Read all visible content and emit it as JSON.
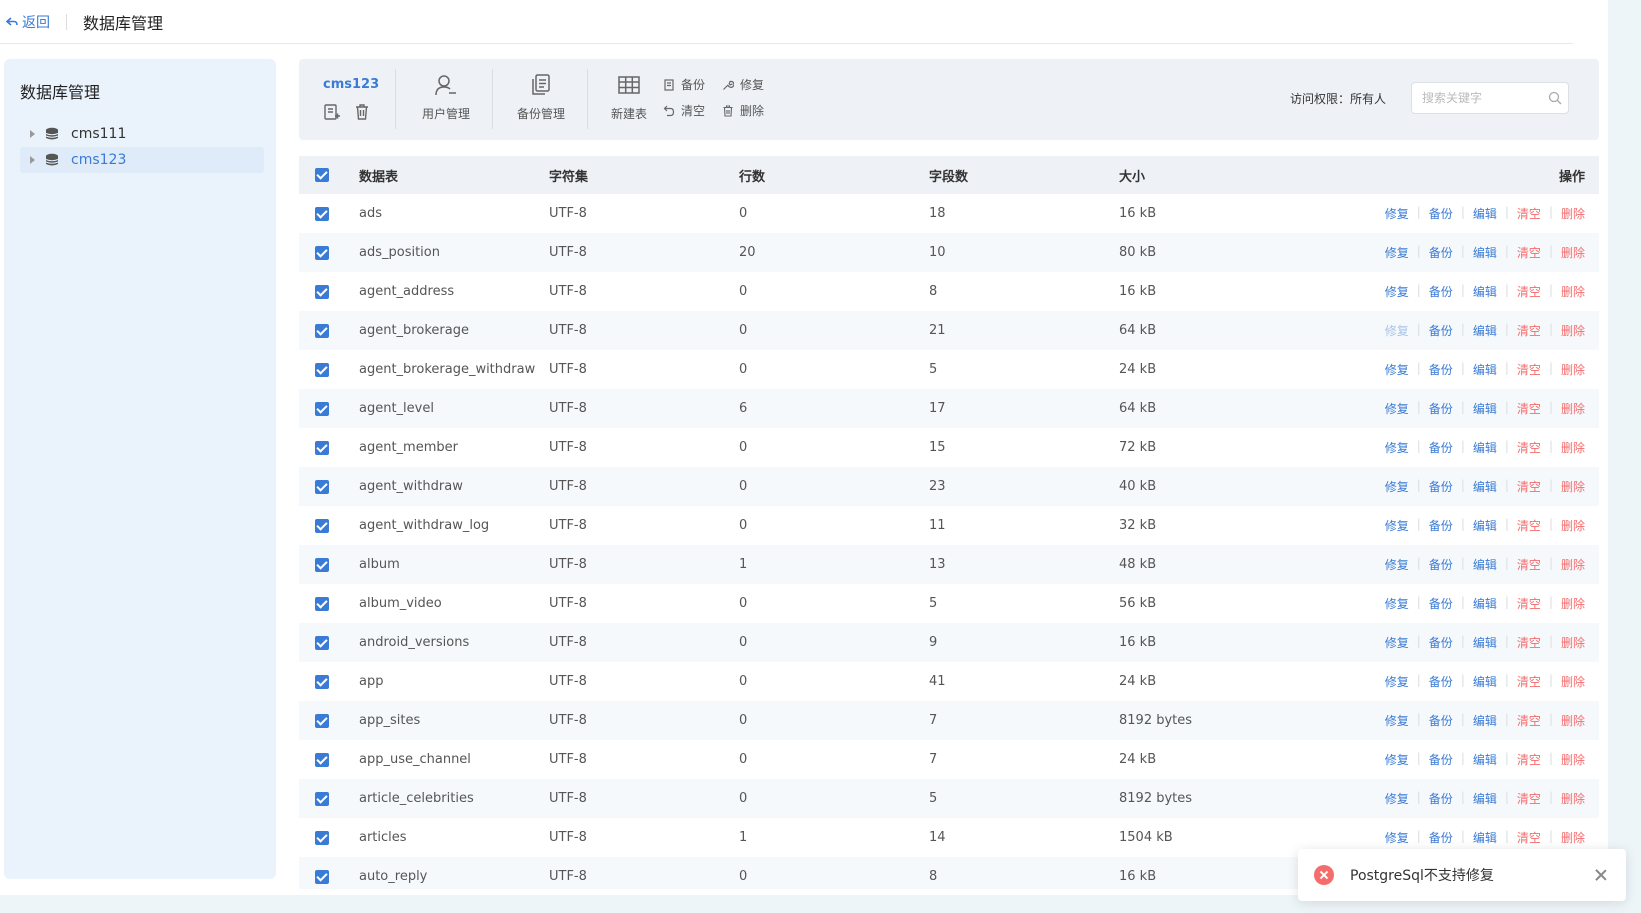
{
  "topbar": {
    "back_label": "返回",
    "title": "数据库管理"
  },
  "sidebar": {
    "title": "数据库管理",
    "databases": [
      {
        "name": "cms111",
        "active": false
      },
      {
        "name": "cms123",
        "active": true
      }
    ]
  },
  "toolbar": {
    "db_name": "cms123",
    "user_mgmt": "用户管理",
    "backup_mgmt": "备份管理",
    "new_table": "新建表",
    "backup": "备份",
    "repair": "修复",
    "clear": "清空",
    "delete": "删除",
    "permission": "访问权限：所有人",
    "search_placeholder": "搜索关键字"
  },
  "table": {
    "headers": [
      "数据表",
      "字符集",
      "行数",
      "字段数",
      "大小",
      "操作"
    ],
    "ops": [
      "修复",
      "备份",
      "编辑",
      "清空",
      "删除"
    ],
    "rows": [
      [
        "ads",
        "UTF-8",
        "0",
        "18",
        "16 kB"
      ],
      [
        "ads_position",
        "UTF-8",
        "20",
        "10",
        "80 kB"
      ],
      [
        "agent_address",
        "UTF-8",
        "0",
        "8",
        "16 kB"
      ],
      [
        "agent_brokerage",
        "UTF-8",
        "0",
        "21",
        "64 kB"
      ],
      [
        "agent_brokerage_withdraw",
        "UTF-8",
        "0",
        "5",
        "24 kB"
      ],
      [
        "agent_level",
        "UTF-8",
        "6",
        "17",
        "64 kB"
      ],
      [
        "agent_member",
        "UTF-8",
        "0",
        "15",
        "72 kB"
      ],
      [
        "agent_withdraw",
        "UTF-8",
        "0",
        "23",
        "40 kB"
      ],
      [
        "agent_withdraw_log",
        "UTF-8",
        "0",
        "11",
        "32 kB"
      ],
      [
        "album",
        "UTF-8",
        "1",
        "13",
        "48 kB"
      ],
      [
        "album_video",
        "UTF-8",
        "0",
        "5",
        "56 kB"
      ],
      [
        "android_versions",
        "UTF-8",
        "0",
        "9",
        "16 kB"
      ],
      [
        "app",
        "UTF-8",
        "0",
        "41",
        "24 kB"
      ],
      [
        "app_sites",
        "UTF-8",
        "0",
        "7",
        "8192 bytes"
      ],
      [
        "app_use_channel",
        "UTF-8",
        "0",
        "7",
        "24 kB"
      ],
      [
        "article_celebrities",
        "UTF-8",
        "0",
        "5",
        "8192 bytes"
      ],
      [
        "articles",
        "UTF-8",
        "1",
        "14",
        "1504 kB"
      ],
      [
        "auto_reply",
        "UTF-8",
        "0",
        "8",
        "16 kB"
      ]
    ],
    "disabled_repair_row": 3
  },
  "toast": {
    "message": "PostgreSql不支持修复"
  }
}
